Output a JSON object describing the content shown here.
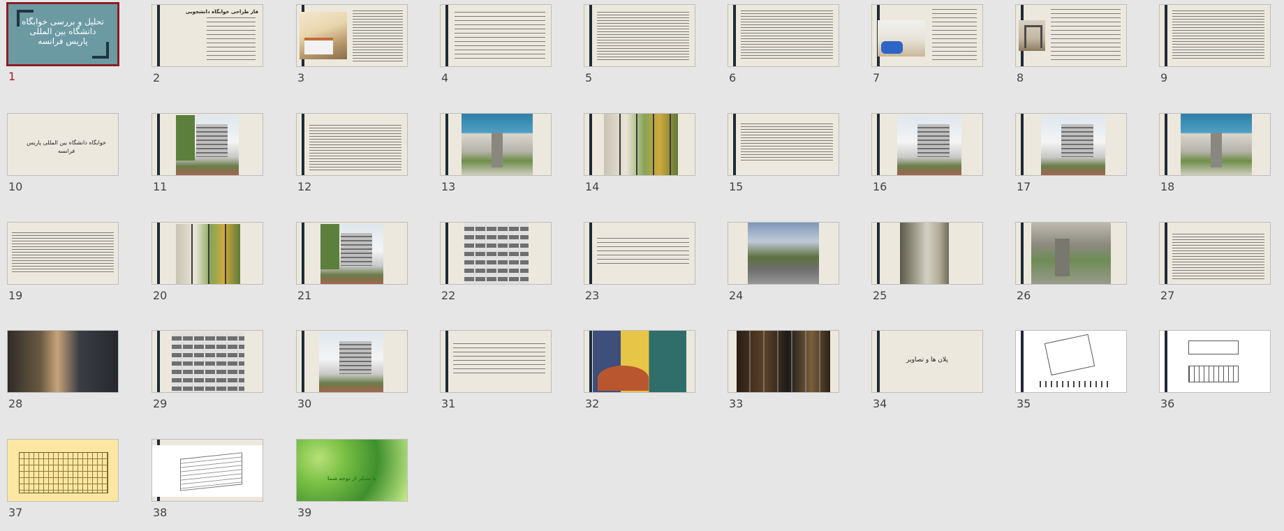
{
  "selected_slide": "1",
  "slides": [
    {
      "number": "1",
      "title": "تحلیل و بررسی خوابگاه دانشگاه بین المللی پاریس فرانسه"
    },
    {
      "number": "2",
      "title": "فاز طراحی خوابگاه دانشجویی"
    },
    {
      "number": "3",
      "title": ""
    },
    {
      "number": "4",
      "title": ""
    },
    {
      "number": "5",
      "title": ""
    },
    {
      "number": "6",
      "title": ""
    },
    {
      "number": "7",
      "title": ""
    },
    {
      "number": "8",
      "title": ""
    },
    {
      "number": "9",
      "title": ""
    },
    {
      "number": "10",
      "title": "خوابگاه دانشگاه بین المللی پاریس فرانسه"
    },
    {
      "number": "11",
      "title": ""
    },
    {
      "number": "12",
      "title": ""
    },
    {
      "number": "13",
      "title": ""
    },
    {
      "number": "14",
      "title": ""
    },
    {
      "number": "15",
      "title": ""
    },
    {
      "number": "16",
      "title": ""
    },
    {
      "number": "17",
      "title": ""
    },
    {
      "number": "18",
      "title": ""
    },
    {
      "number": "19",
      "title": ""
    },
    {
      "number": "20",
      "title": ""
    },
    {
      "number": "21",
      "title": ""
    },
    {
      "number": "22",
      "title": ""
    },
    {
      "number": "23",
      "title": ""
    },
    {
      "number": "24",
      "title": ""
    },
    {
      "number": "25",
      "title": ""
    },
    {
      "number": "26",
      "title": ""
    },
    {
      "number": "27",
      "title": ""
    },
    {
      "number": "28",
      "title": ""
    },
    {
      "number": "29",
      "title": ""
    },
    {
      "number": "30",
      "title": ""
    },
    {
      "number": "31",
      "title": ""
    },
    {
      "number": "32",
      "title": ""
    },
    {
      "number": "33",
      "title": ""
    },
    {
      "number": "34",
      "title": "پلان ها و تصاویر"
    },
    {
      "number": "35",
      "title": ""
    },
    {
      "number": "36",
      "title": ""
    },
    {
      "number": "37",
      "title": ""
    },
    {
      "number": "38",
      "title": ""
    },
    {
      "number": "39",
      "title": "با تشکر از توجه شما"
    }
  ],
  "colors": {
    "selection_border": "#8b1e23",
    "slide_background": "#ece8dd",
    "title_slide_background": "#6c9aa3",
    "accent_bar": "#1f2a36"
  }
}
